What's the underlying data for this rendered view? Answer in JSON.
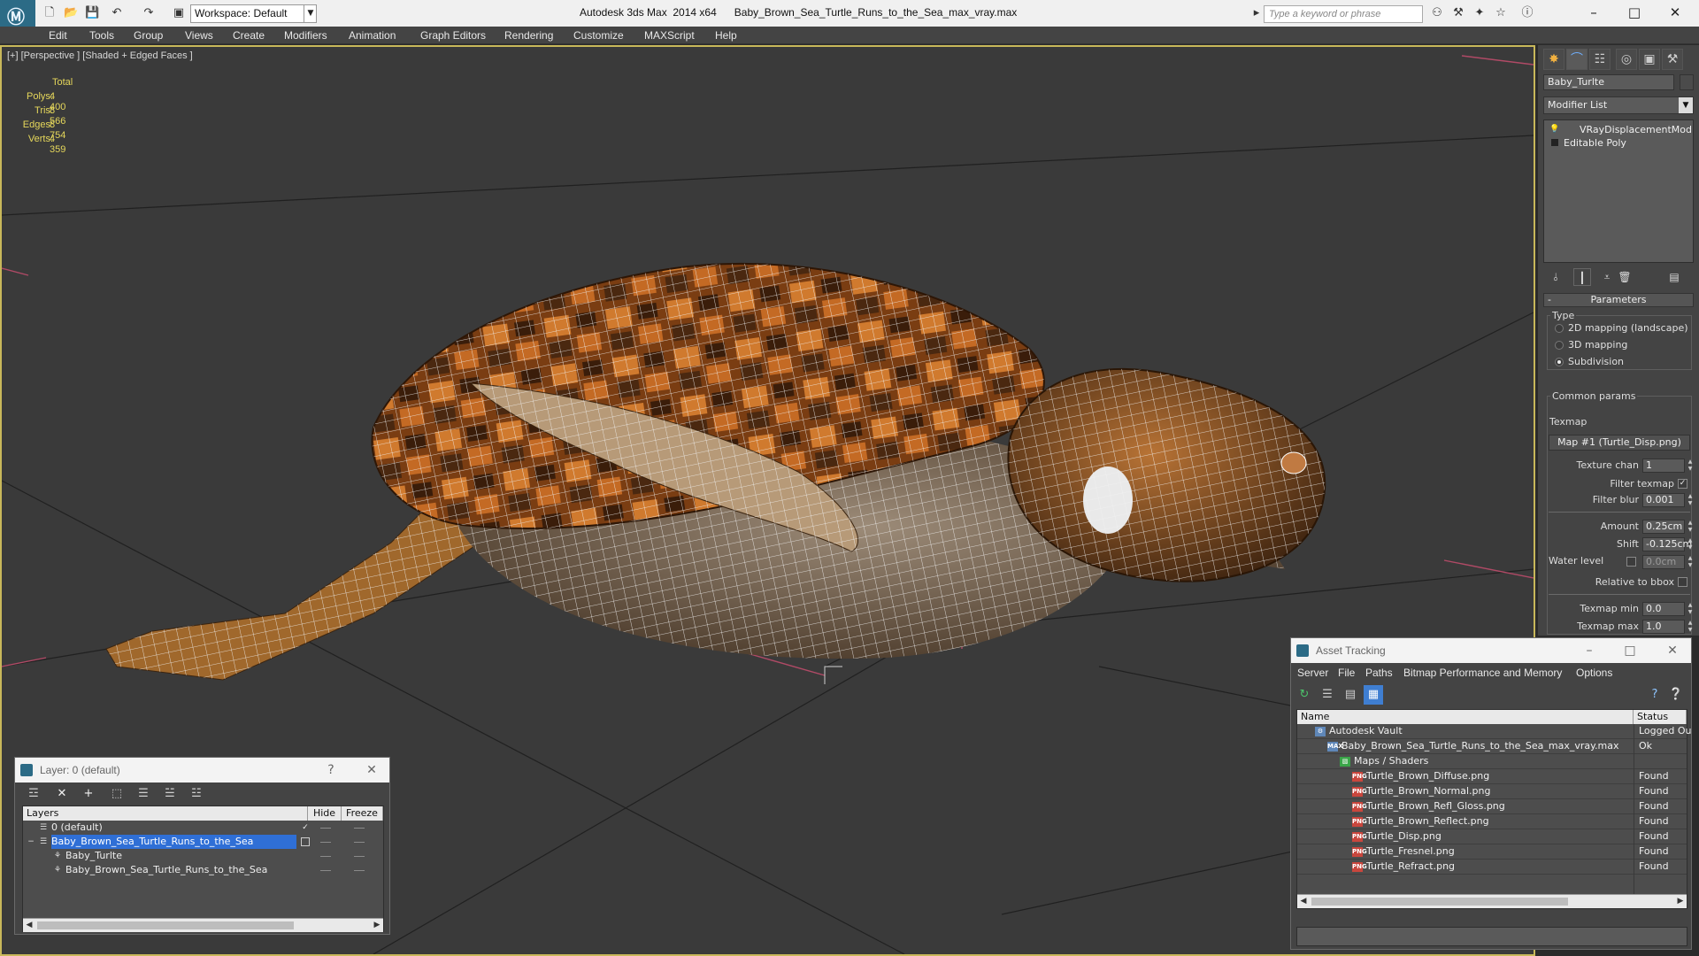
{
  "titlebar": {
    "workspace": "Workspace: Default",
    "title": "Autodesk 3ds Max  2014 x64      Baby_Brown_Sea_Turtle_Runs_to_the_Sea_max_vray.max",
    "search_placeholder": "Type a keyword or phrase"
  },
  "menu": [
    "Edit",
    "Tools",
    "Group",
    "Views",
    "Create",
    "Modifiers",
    "Animation",
    "Graph Editors",
    "Rendering",
    "Customize",
    "MAXScript",
    "Help"
  ],
  "viewport": {
    "label": "[+] [Perspective ] [Shaded + Edged Faces ]",
    "stats": {
      "header": "Total",
      "rows": [
        {
          "label": "Polys:",
          "value": "4 400"
        },
        {
          "label": "Tris:",
          "value": "8 566"
        },
        {
          "label": "Edges:",
          "value": "8 754"
        },
        {
          "label": "Verts:",
          "value": "4 359"
        }
      ]
    }
  },
  "command_panel": {
    "object_name": "Baby_Turlte",
    "modifier_list": "Modifier List",
    "stack": [
      "VRayDisplacementMod",
      "Editable Poly"
    ],
    "parameters_title": "Parameters",
    "type_group": "Type",
    "type_options": [
      {
        "label": "2D mapping (landscape)",
        "selected": false
      },
      {
        "label": "3D mapping",
        "selected": false
      },
      {
        "label": "Subdivision",
        "selected": true
      }
    ],
    "common_params": "Common params",
    "texmap_label": "Texmap",
    "texmap_button": "Map #1 (Turtle_Disp.png)",
    "texture_chan": {
      "label": "Texture chan",
      "value": "1"
    },
    "filter_texmap": {
      "label": "Filter texmap",
      "checked": true
    },
    "filter_blur": {
      "label": "Filter blur",
      "value": "0.001"
    },
    "amount": {
      "label": "Amount",
      "value": "0.25cm"
    },
    "shift": {
      "label": "Shift",
      "value": "-0.125cm"
    },
    "water_level": {
      "label": "Water level",
      "value": "0.0cm"
    },
    "relative_to_bbox": {
      "label": "Relative to bbox",
      "checked": false
    },
    "texmap_min": {
      "label": "Texmap min",
      "value": "0.0"
    },
    "texmap_max": {
      "label": "Texmap max",
      "value": "1.0"
    }
  },
  "layer_dialog": {
    "title": "Layer: 0 (default)",
    "help": "?",
    "columns": [
      "Layers",
      "Hide",
      "Freeze"
    ],
    "rows": [
      {
        "name": "0 (default)",
        "indent": 1,
        "active": true,
        "selected": false
      },
      {
        "name": "Baby_Brown_Sea_Turtle_Runs_to_the_Sea",
        "indent": 1,
        "active": false,
        "selected": true
      },
      {
        "name": "Baby_Turlte",
        "indent": 2,
        "active": false,
        "selected": false
      },
      {
        "name": "Baby_Brown_Sea_Turtle_Runs_to_the_Sea",
        "indent": 2,
        "active": false,
        "selected": false
      }
    ]
  },
  "asset_dialog": {
    "title": "Asset Tracking",
    "menu": [
      "Server",
      "File",
      "Paths",
      "Bitmap Performance and Memory",
      "Options"
    ],
    "columns": [
      "Name",
      "Status"
    ],
    "rows": [
      {
        "name": "Autodesk Vault",
        "status": "Logged Ou",
        "indent": 1,
        "icon": "vault-icon"
      },
      {
        "name": "Baby_Brown_Sea_Turtle_Runs_to_the_Sea_max_vray.max",
        "status": "Ok",
        "indent": 2,
        "icon": "max-file-icon"
      },
      {
        "name": "Maps / Shaders",
        "status": "",
        "indent": 3,
        "icon": "maps-folder-icon"
      },
      {
        "name": "Turtle_Brown_Diffuse.png",
        "status": "Found",
        "indent": 4,
        "icon": "png-icon"
      },
      {
        "name": "Turtle_Brown_Normal.png",
        "status": "Found",
        "indent": 4,
        "icon": "png-icon"
      },
      {
        "name": "Turtle_Brown_Refl_Gloss.png",
        "status": "Found",
        "indent": 4,
        "icon": "png-icon"
      },
      {
        "name": "Turtle_Brown_Reflect.png",
        "status": "Found",
        "indent": 4,
        "icon": "png-icon"
      },
      {
        "name": "Turtle_Disp.png",
        "status": "Found",
        "indent": 4,
        "icon": "png-icon"
      },
      {
        "name": "Turtle_Fresnel.png",
        "status": "Found",
        "indent": 4,
        "icon": "png-icon"
      },
      {
        "name": "Turtle_Refract.png",
        "status": "Found",
        "indent": 4,
        "icon": "png-icon"
      }
    ]
  },
  "colors": {
    "stats_text": "#e5d75b",
    "selection": "#2f6fd6",
    "viewport_bg": "#3a3a3a",
    "viewport_border": "#c8b85a"
  }
}
